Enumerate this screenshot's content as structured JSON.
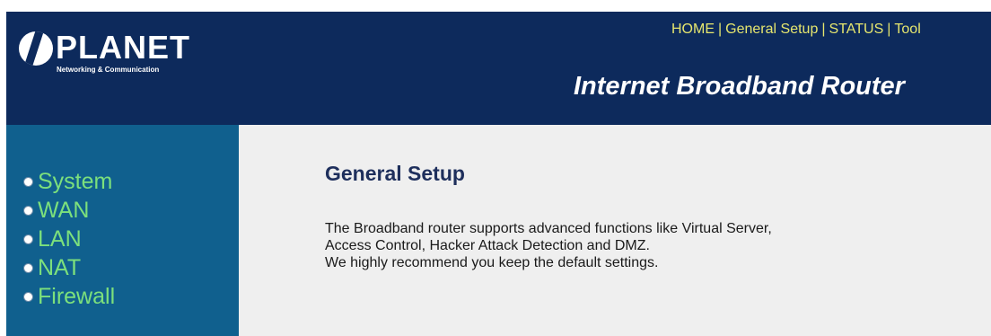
{
  "header": {
    "logo_text": "PLANET",
    "logo_subtitle": "Networking & Communication",
    "product_title": "Internet Broadband Router",
    "nav": [
      {
        "label": "HOME"
      },
      {
        "label": "General Setup"
      },
      {
        "label": "STATUS"
      },
      {
        "label": "Tool"
      }
    ]
  },
  "sidebar": {
    "items": [
      {
        "label": "System"
      },
      {
        "label": "WAN"
      },
      {
        "label": "LAN"
      },
      {
        "label": "NAT"
      },
      {
        "label": "Firewall"
      }
    ]
  },
  "main": {
    "title": "General Setup",
    "description": [
      "The Broadband router supports advanced functions like Virtual Server,",
      "Access Control, Hacker Attack Detection and DMZ.",
      "We highly recommend you keep the default settings."
    ]
  },
  "colors": {
    "header_bg": "#0d2a5c",
    "sidebar_bg": "#10608e",
    "content_bg": "#efefef",
    "nav_text": "#e6e66e",
    "menu_text": "#7ce07c",
    "title_text": "#1e2f5c"
  }
}
